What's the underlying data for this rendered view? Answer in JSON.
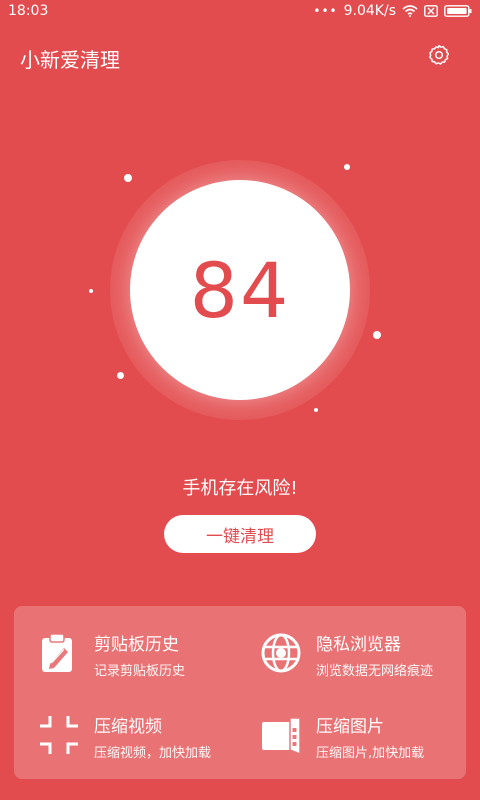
{
  "status_bar": {
    "time": "18:03",
    "dots": "•••",
    "network_speed": "9.04K/s",
    "icons": [
      "wifi-icon",
      "sim-disabled-icon",
      "battery-icon"
    ]
  },
  "header": {
    "title": "小新爱清理",
    "settings_icon": "gear-icon"
  },
  "score": {
    "value": "84"
  },
  "risk_message": "手机存在风险!",
  "clean_button": {
    "label": "一键清理"
  },
  "features": [
    {
      "icon": "clipboard-icon",
      "title": "剪贴板历史",
      "subtitle": "记录剪贴板历史"
    },
    {
      "icon": "browser-globe-icon",
      "title": "隐私浏览器",
      "subtitle": "浏览数据无网络痕迹"
    },
    {
      "icon": "compress-video-icon",
      "title": "压缩视频",
      "subtitle": "压缩视频，加快加载"
    },
    {
      "icon": "compress-image-icon",
      "title": "压缩图片",
      "subtitle": "压缩图片,加快加载"
    }
  ],
  "colors": {
    "background": "#e34c4e",
    "score_text": "#e34c4e",
    "button_text": "#e34c4e",
    "panel": "rgba(255,255,255,0.22)"
  }
}
